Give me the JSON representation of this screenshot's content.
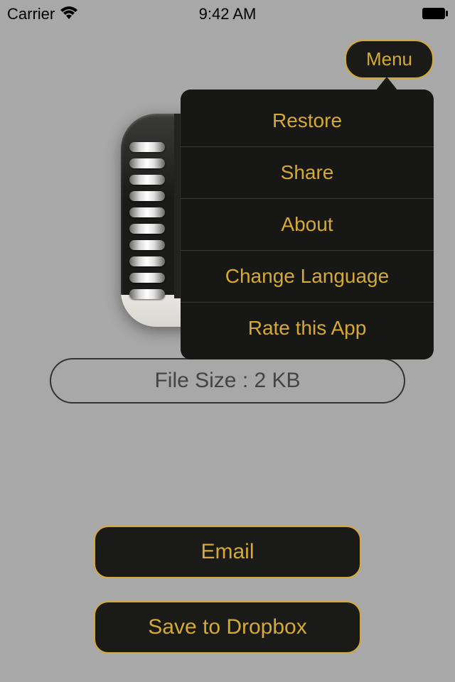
{
  "status": {
    "carrier": "Carrier",
    "time": "9:42 AM"
  },
  "menu": {
    "button_label": "Menu",
    "items": [
      "Restore",
      "Share",
      "About",
      "Change Language",
      "Rate this App"
    ]
  },
  "file_size_label": "File Size : 2 KB",
  "actions": {
    "email_label": "Email",
    "dropbox_label": "Save to Dropbox"
  }
}
